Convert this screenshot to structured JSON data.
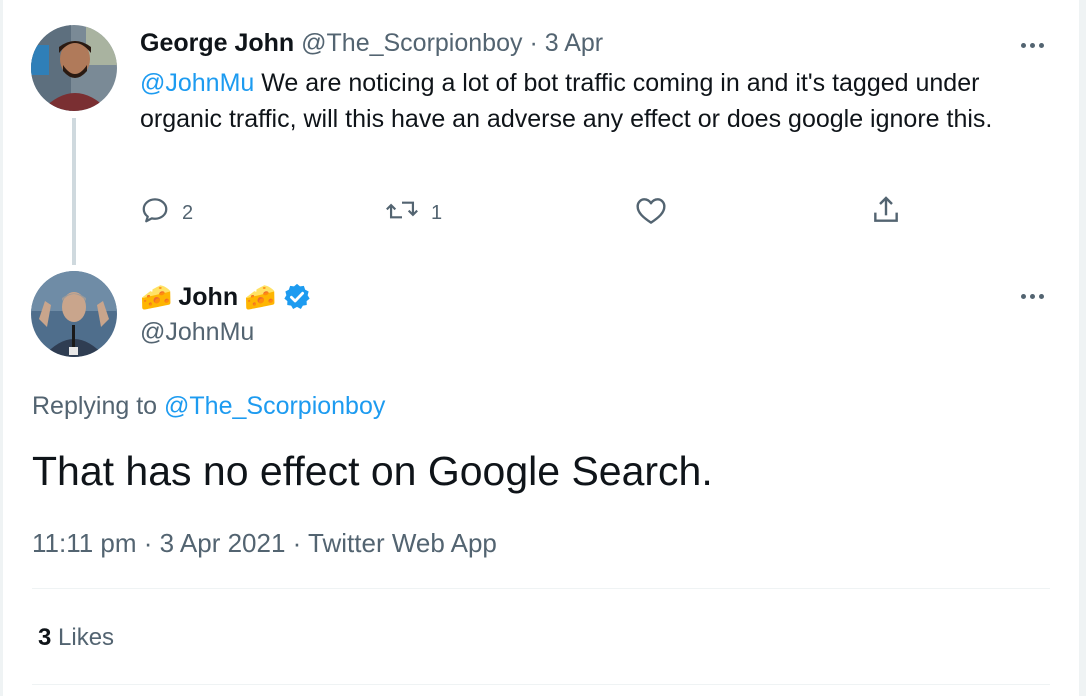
{
  "parent_tweet": {
    "name": "George John",
    "handle": "@The_Scorpionboy",
    "separator": "·",
    "date": "3 Apr",
    "mention": "@JohnMu",
    "text": " We are noticing a lot of bot traffic coming in and it's tagged under organic traffic, will this have an adverse any effect or does google ignore this.",
    "actions": {
      "reply_icon": "reply-icon",
      "reply_count": "2",
      "retweet_icon": "retweet-icon",
      "retweet_count": "1",
      "like_icon": "heart-icon",
      "share_icon": "share-icon"
    }
  },
  "main_tweet": {
    "name_prefix_emoji": "🧀",
    "name": "John",
    "name_suffix_emoji": "🧀",
    "verified_icon": "verified-badge-icon",
    "handle": "@JohnMu",
    "replying_label": "Replying to",
    "replying_to": "@The_Scorpionboy",
    "text": "That has no effect on Google Search.",
    "timestamp": "11:11 pm · 3 Apr 2021 · Twitter Web App",
    "likes_count": "3",
    "likes_label": "Likes"
  },
  "colors": {
    "accent": "#1d9bf0",
    "text": "#0f1419",
    "muted": "#536471",
    "divider": "#eff3f4",
    "thread_line": "#cfd9de"
  }
}
